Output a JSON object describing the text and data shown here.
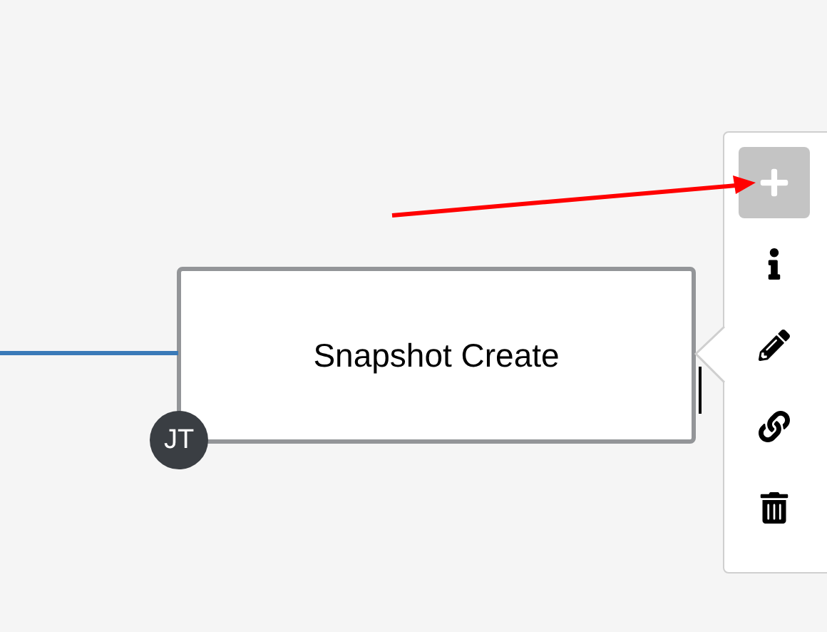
{
  "node": {
    "label": "Snapshot Create",
    "avatar": "JT"
  },
  "toolbar": [
    {
      "kind": "add",
      "selected": true
    },
    {
      "kind": "info",
      "selected": false
    },
    {
      "kind": "edit",
      "selected": false
    },
    {
      "kind": "link",
      "selected": false
    },
    {
      "kind": "delete",
      "selected": false
    }
  ]
}
